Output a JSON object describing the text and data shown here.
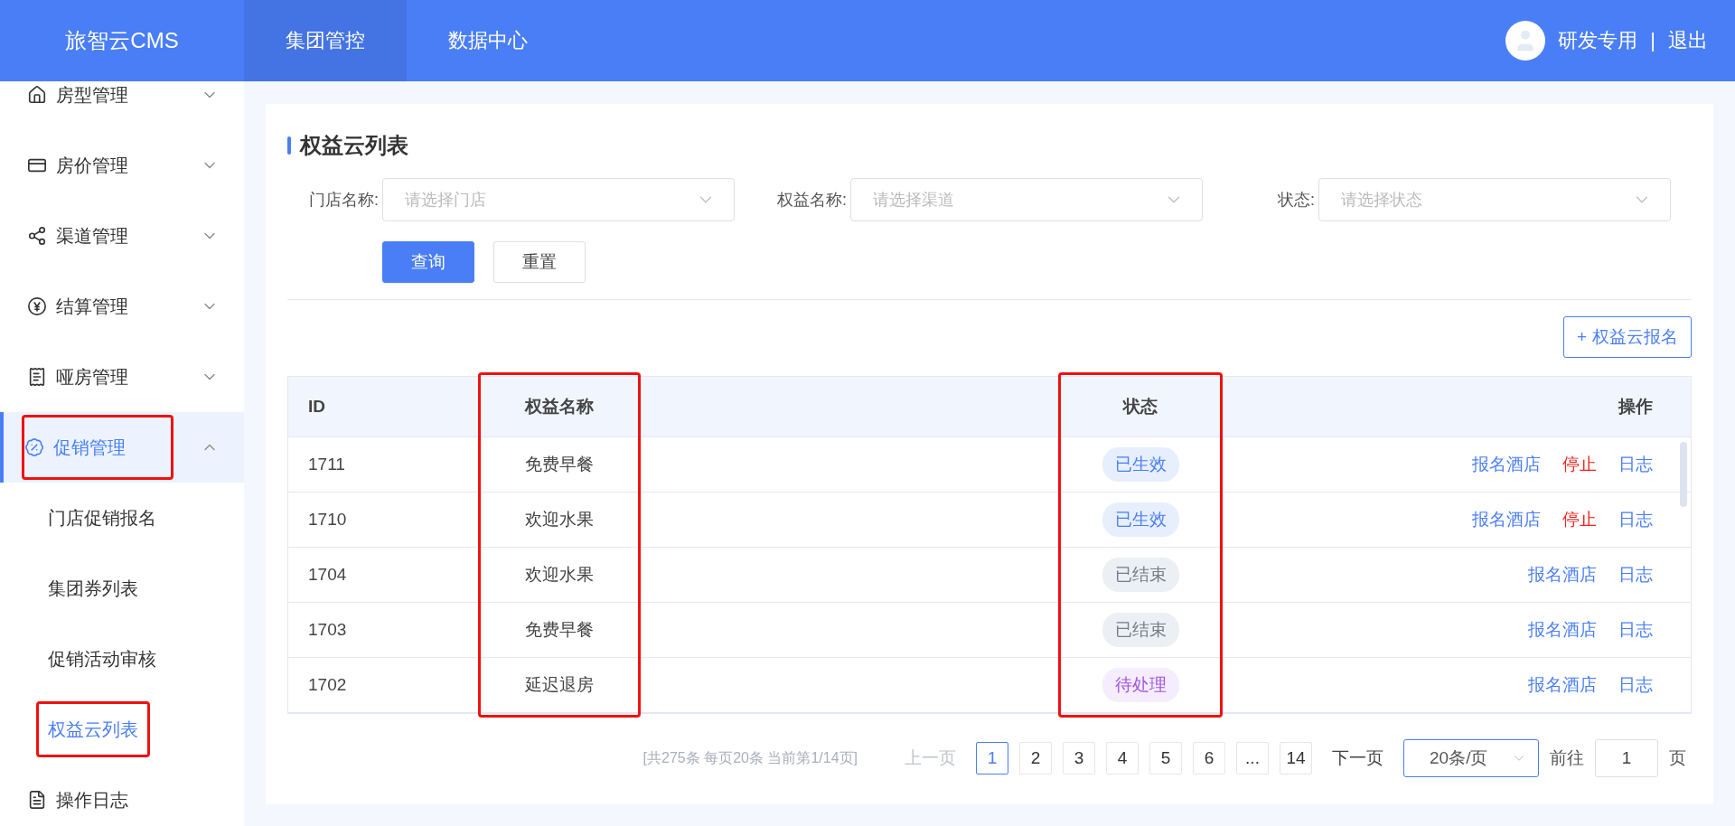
{
  "header": {
    "logo": "旅智云CMS",
    "nav": [
      {
        "label": "集团管控",
        "selected": true
      },
      {
        "label": "数据中心",
        "selected": false
      }
    ],
    "user": "研发专用",
    "separator": "|",
    "logout": "退出"
  },
  "sidebar": {
    "items": [
      {
        "label": "房型管理",
        "kind": "group",
        "expanded": false,
        "selected": false,
        "highlighted": false
      },
      {
        "label": "房价管理",
        "kind": "group",
        "expanded": false,
        "selected": false,
        "highlighted": false
      },
      {
        "label": "渠道管理",
        "kind": "group",
        "expanded": false,
        "selected": false,
        "highlighted": false
      },
      {
        "label": "结算管理",
        "kind": "group",
        "expanded": false,
        "selected": false,
        "highlighted": false
      },
      {
        "label": "哑房管理",
        "kind": "group",
        "expanded": false,
        "selected": false,
        "highlighted": false
      },
      {
        "label": "促销管理",
        "kind": "group",
        "expanded": true,
        "selected": true,
        "highlighted": true,
        "children": [
          {
            "label": "门店促销报名",
            "selected": false,
            "highlighted": false
          },
          {
            "label": "集团券列表",
            "selected": false,
            "highlighted": false
          },
          {
            "label": "促销活动审核",
            "selected": false,
            "highlighted": false
          },
          {
            "label": "权益云列表",
            "selected": true,
            "highlighted": true
          }
        ]
      },
      {
        "label": "操作日志",
        "kind": "page",
        "selected": false,
        "highlighted": false
      }
    ]
  },
  "page": {
    "title": "权益云列表",
    "filters": [
      {
        "label": "门店名称:",
        "placeholder": "请选择门店"
      },
      {
        "label": "权益名称:",
        "placeholder": "请选择渠道"
      },
      {
        "label": "状态:",
        "placeholder": "请选择状态"
      }
    ],
    "buttons": [
      {
        "label": "查询",
        "kind": "primary"
      },
      {
        "label": "重置",
        "kind": "default"
      }
    ],
    "add_button": {
      "icon": "+",
      "label": "权益云报名"
    }
  },
  "table": {
    "columns": [
      {
        "label": "ID",
        "highlighted": false
      },
      {
        "label": "权益名称",
        "highlighted": true
      },
      {
        "highlighted": false
      },
      {
        "label": "状态",
        "highlighted": true
      },
      {
        "label": "操作",
        "highlighted": false
      }
    ],
    "rows": [
      {
        "id": "1711",
        "name": "免费早餐",
        "status": {
          "label": "已生效",
          "kind": "active"
        },
        "actions": [
          {
            "label": "报名酒店",
            "kind": "link"
          },
          {
            "label": "停止",
            "kind": "danger"
          },
          {
            "label": "日志",
            "kind": "link"
          }
        ]
      },
      {
        "id": "1710",
        "name": "欢迎水果",
        "status": {
          "label": "已生效",
          "kind": "active"
        },
        "actions": [
          {
            "label": "报名酒店",
            "kind": "link"
          },
          {
            "label": "停止",
            "kind": "danger"
          },
          {
            "label": "日志",
            "kind": "link"
          }
        ]
      },
      {
        "id": "1704",
        "name": "欢迎水果",
        "status": {
          "label": "已结束",
          "kind": "ended"
        },
        "actions": [
          {
            "label": "报名酒店",
            "kind": "link"
          },
          {
            "label": "日志",
            "kind": "link"
          }
        ]
      },
      {
        "id": "1703",
        "name": "免费早餐",
        "status": {
          "label": "已结束",
          "kind": "ended"
        },
        "actions": [
          {
            "label": "报名酒店",
            "kind": "link"
          },
          {
            "label": "日志",
            "kind": "link"
          }
        ]
      },
      {
        "id": "1702",
        "name": "延迟退房",
        "status": {
          "label": "待处理",
          "kind": "pending"
        },
        "actions": [
          {
            "label": "报名酒店",
            "kind": "link"
          },
          {
            "label": "日志",
            "kind": "link"
          }
        ]
      }
    ]
  },
  "pagination": {
    "summary": "[共275条 每页20条 当前第1/14页]",
    "prev": {
      "label": "上一页",
      "disabled": true
    },
    "pages": [
      {
        "label": "1",
        "selected": true
      },
      {
        "label": "2",
        "selected": false
      },
      {
        "label": "3",
        "selected": false
      },
      {
        "label": "4",
        "selected": false
      },
      {
        "label": "5",
        "selected": false
      },
      {
        "label": "6",
        "selected": false
      },
      {
        "label": "...",
        "selected": false
      },
      {
        "label": "14",
        "selected": false
      }
    ],
    "next": {
      "label": "下一页",
      "disabled": false
    },
    "page_size": "20条/页",
    "goto_label": "前往",
    "goto_value": "1",
    "goto_suffix": "页"
  }
}
